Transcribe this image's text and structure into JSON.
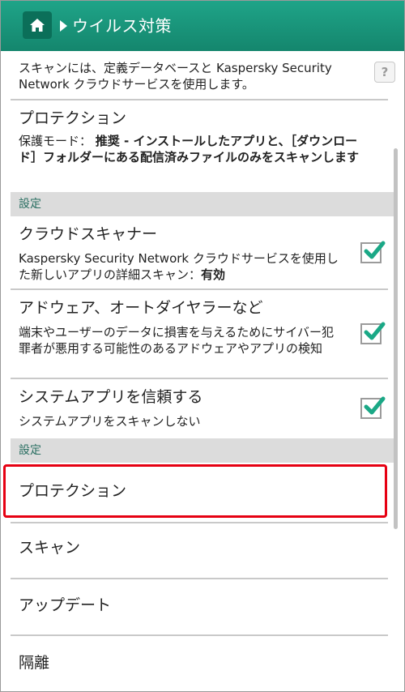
{
  "header": {
    "title": "ウイルス対策",
    "home_icon": "home-icon",
    "breadcrumb_icon": "breadcrumb-arrow-icon",
    "background_color": "#1a9a7e"
  },
  "scan_intro": {
    "text": "スキャンには、定義データベースと Kaspersky Security Network クラウドサービスを使用します。",
    "help_label": "?"
  },
  "protection_summary": {
    "title": "プロテクション",
    "desc_prefix": "保護モード：",
    "desc_bold": "推奨 - インストールしたアプリと、［ダウンロード］フォルダーにある配信済みファイルのみをスキャンします"
  },
  "sections": [
    {
      "header": "設定",
      "items": [
        {
          "title": "クラウドスキャナー",
          "desc": "Kaspersky Security Network クラウドサービスを使用した新しいアプリの詳細スキャン：",
          "desc_bold": "有効",
          "checked": true
        },
        {
          "title": "アドウェア、オートダイヤラーなど",
          "desc": "端末やユーザーのデータに損害を与えるためにサイバー犯罪者が悪用する可能性のあるアドウェアやアプリの検知",
          "checked": true
        },
        {
          "title": "システムアプリを信頼する",
          "desc": "システムアプリをスキャンしない",
          "checked": true
        }
      ]
    },
    {
      "header": "設定",
      "items": [
        {
          "title": "プロテクション",
          "highlighted": true
        },
        {
          "title": "スキャン"
        },
        {
          "title": "アップデート"
        },
        {
          "title": "隔離"
        }
      ]
    }
  ],
  "colors": {
    "accent_green": "#1a9a7e",
    "check_green": "#1aa886",
    "highlight_red": "#e60012",
    "section_bg": "#dcdcdc"
  }
}
